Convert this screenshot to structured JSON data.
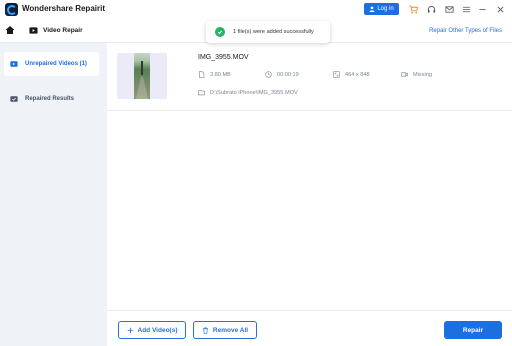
{
  "app": {
    "title": "Wondershare Repairit",
    "login_label": "Log in"
  },
  "titlebar_icons": [
    "cart-icon",
    "headset-icon",
    "mail-icon",
    "menu-icon",
    "minimize-icon",
    "close-icon"
  ],
  "nav": {
    "section_title": "Video Repair",
    "repair_other_link": "Repair Other Types of Files"
  },
  "toast": {
    "message": "1 file(s) were added successfully"
  },
  "sidebar": {
    "items": [
      {
        "label": "Unrepaired Videos (1)",
        "active": true
      },
      {
        "label": "Repaired Results",
        "active": false
      }
    ]
  },
  "file": {
    "name": "IMG_3955.MOV",
    "size": "3.80  MB",
    "duration": "00:00:19",
    "resolution": "464 x 848",
    "camera": "Missing",
    "path": "D:\\Subrato iPhone\\IMG_3955.MOV"
  },
  "buttons": {
    "add_videos": "Add Video(s)",
    "remove_all": "Remove All",
    "repair": "Repair"
  },
  "colors": {
    "accent": "#1c6fe0",
    "success": "#28b463",
    "sidebar_bg": "#eff2f6"
  }
}
